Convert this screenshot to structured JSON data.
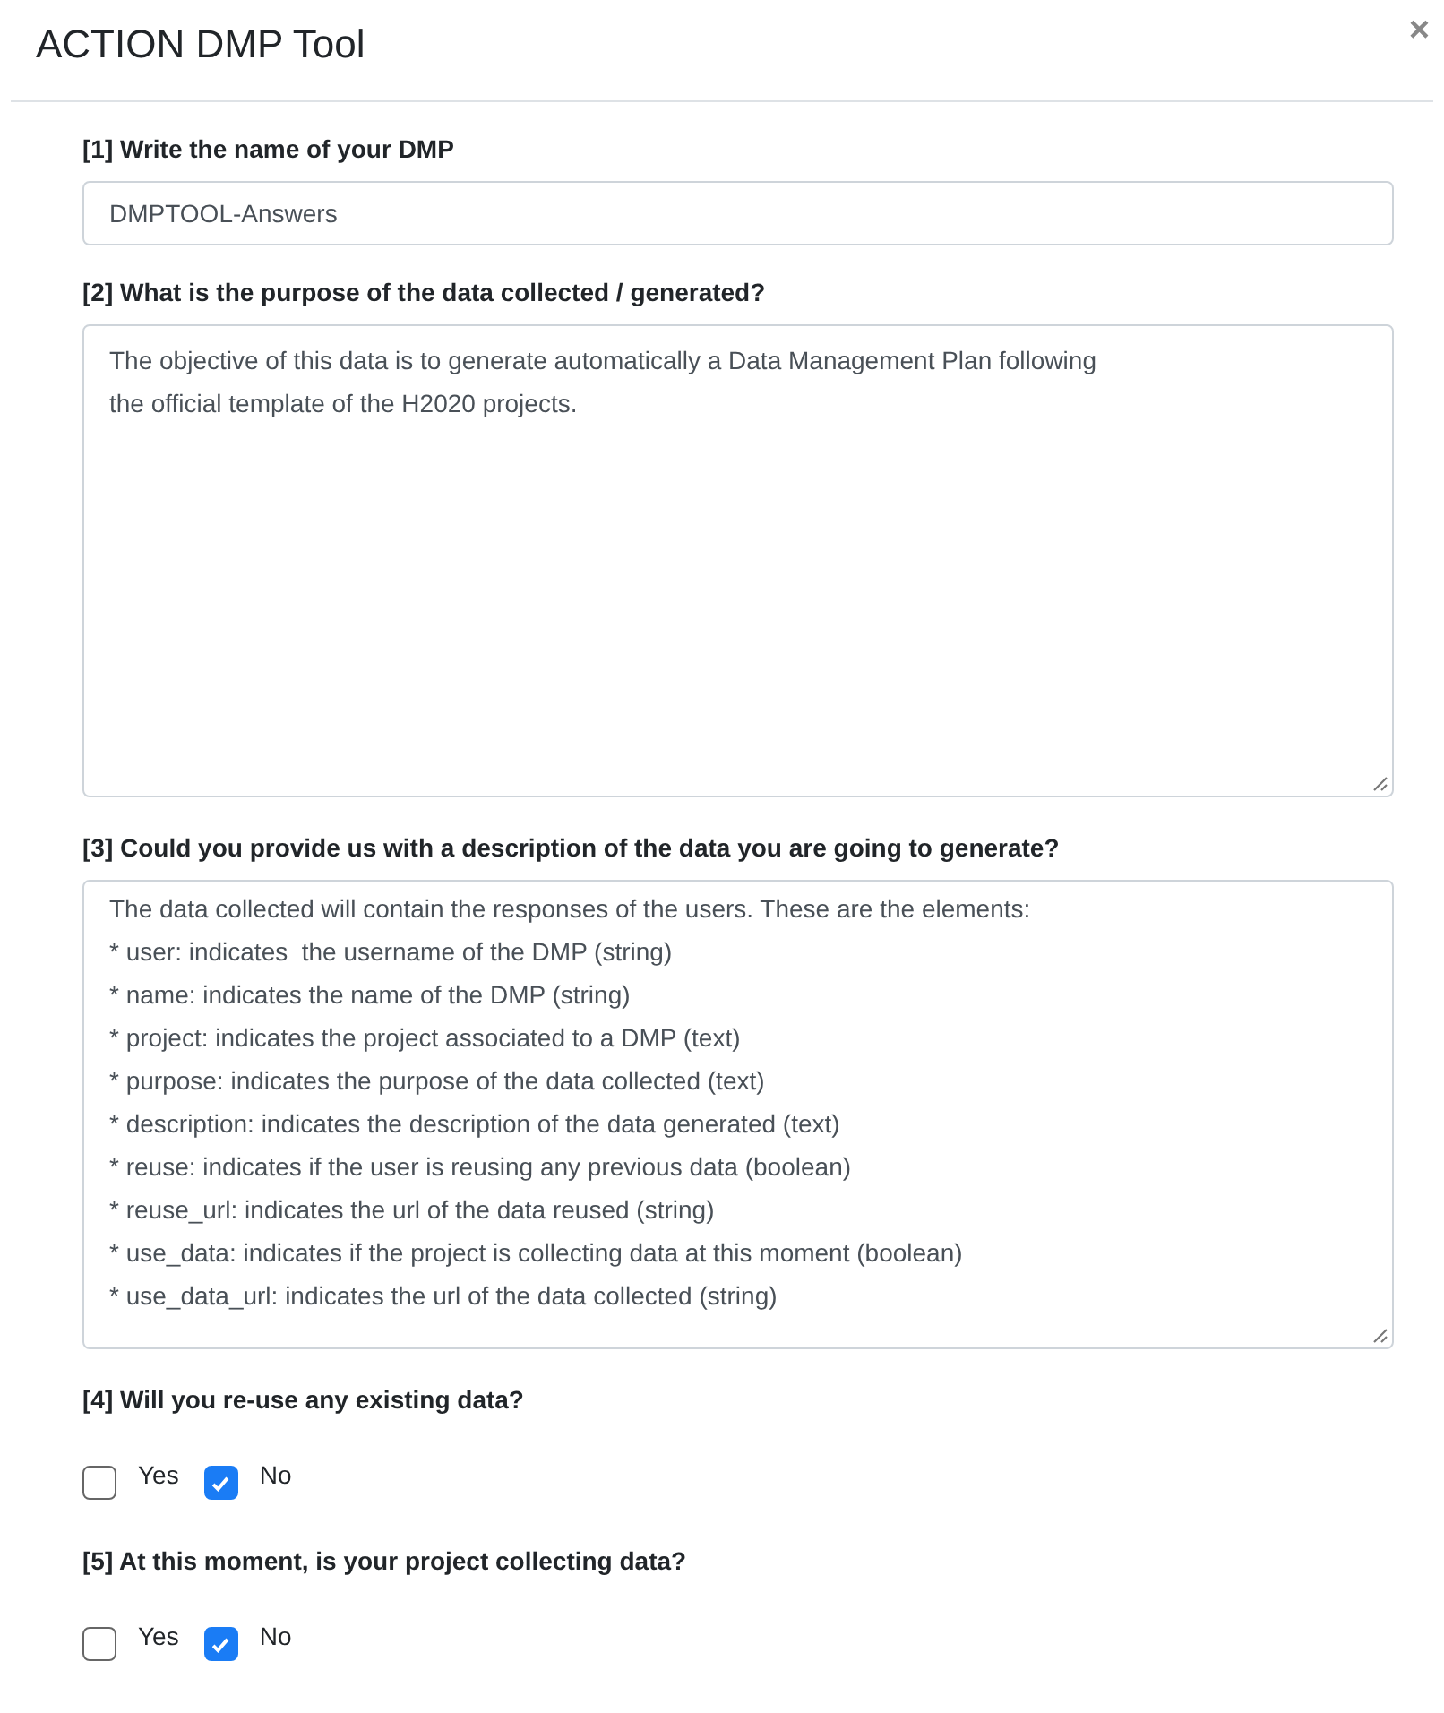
{
  "window": {
    "title": "ACTION DMP Tool",
    "close": "×"
  },
  "questions": [
    {
      "kind": "input",
      "label": "[1] Write the name of your DMP",
      "value": "DMPTOOL-Answers"
    },
    {
      "kind": "textarea",
      "label": "[2] What is the purpose of the data collected / generated?",
      "lines": [
        "The objective of this data is to generate automatically a Data Management Plan following",
        "the official template of the H2020 projects."
      ]
    },
    {
      "kind": "textarea",
      "label": "[3] Could you provide us with a description of the data you are going to generate?",
      "lines": [
        "The data collected will contain the responses of the users. These are the elements:",
        "* user: indicates  the username of the DMP (string)",
        "* name: indicates the name of the DMP (string)",
        "* project: indicates the project associated to a DMP (text)",
        "* purpose: indicates the purpose of the data collected (text)",
        "* description: indicates the description of the data generated (text)",
        "* reuse: indicates if the user is reusing any previous data (boolean)",
        "* reuse_url: indicates the url of the data reused (string)",
        "* use_data: indicates if the project is collecting data at this moment (boolean)",
        "* use_data_url: indicates the url of the data collected (string)"
      ]
    },
    {
      "kind": "checkboxes",
      "label": "[4] Will you re-use any existing data?",
      "options": [
        {
          "label": "Yes",
          "checked": false
        },
        {
          "label": "No",
          "checked": true
        }
      ]
    },
    {
      "kind": "checkboxes",
      "label": "[5] At this moment, is your project collecting data?",
      "options": [
        {
          "label": "Yes",
          "checked": false
        },
        {
          "label": "No",
          "checked": true
        }
      ]
    }
  ]
}
